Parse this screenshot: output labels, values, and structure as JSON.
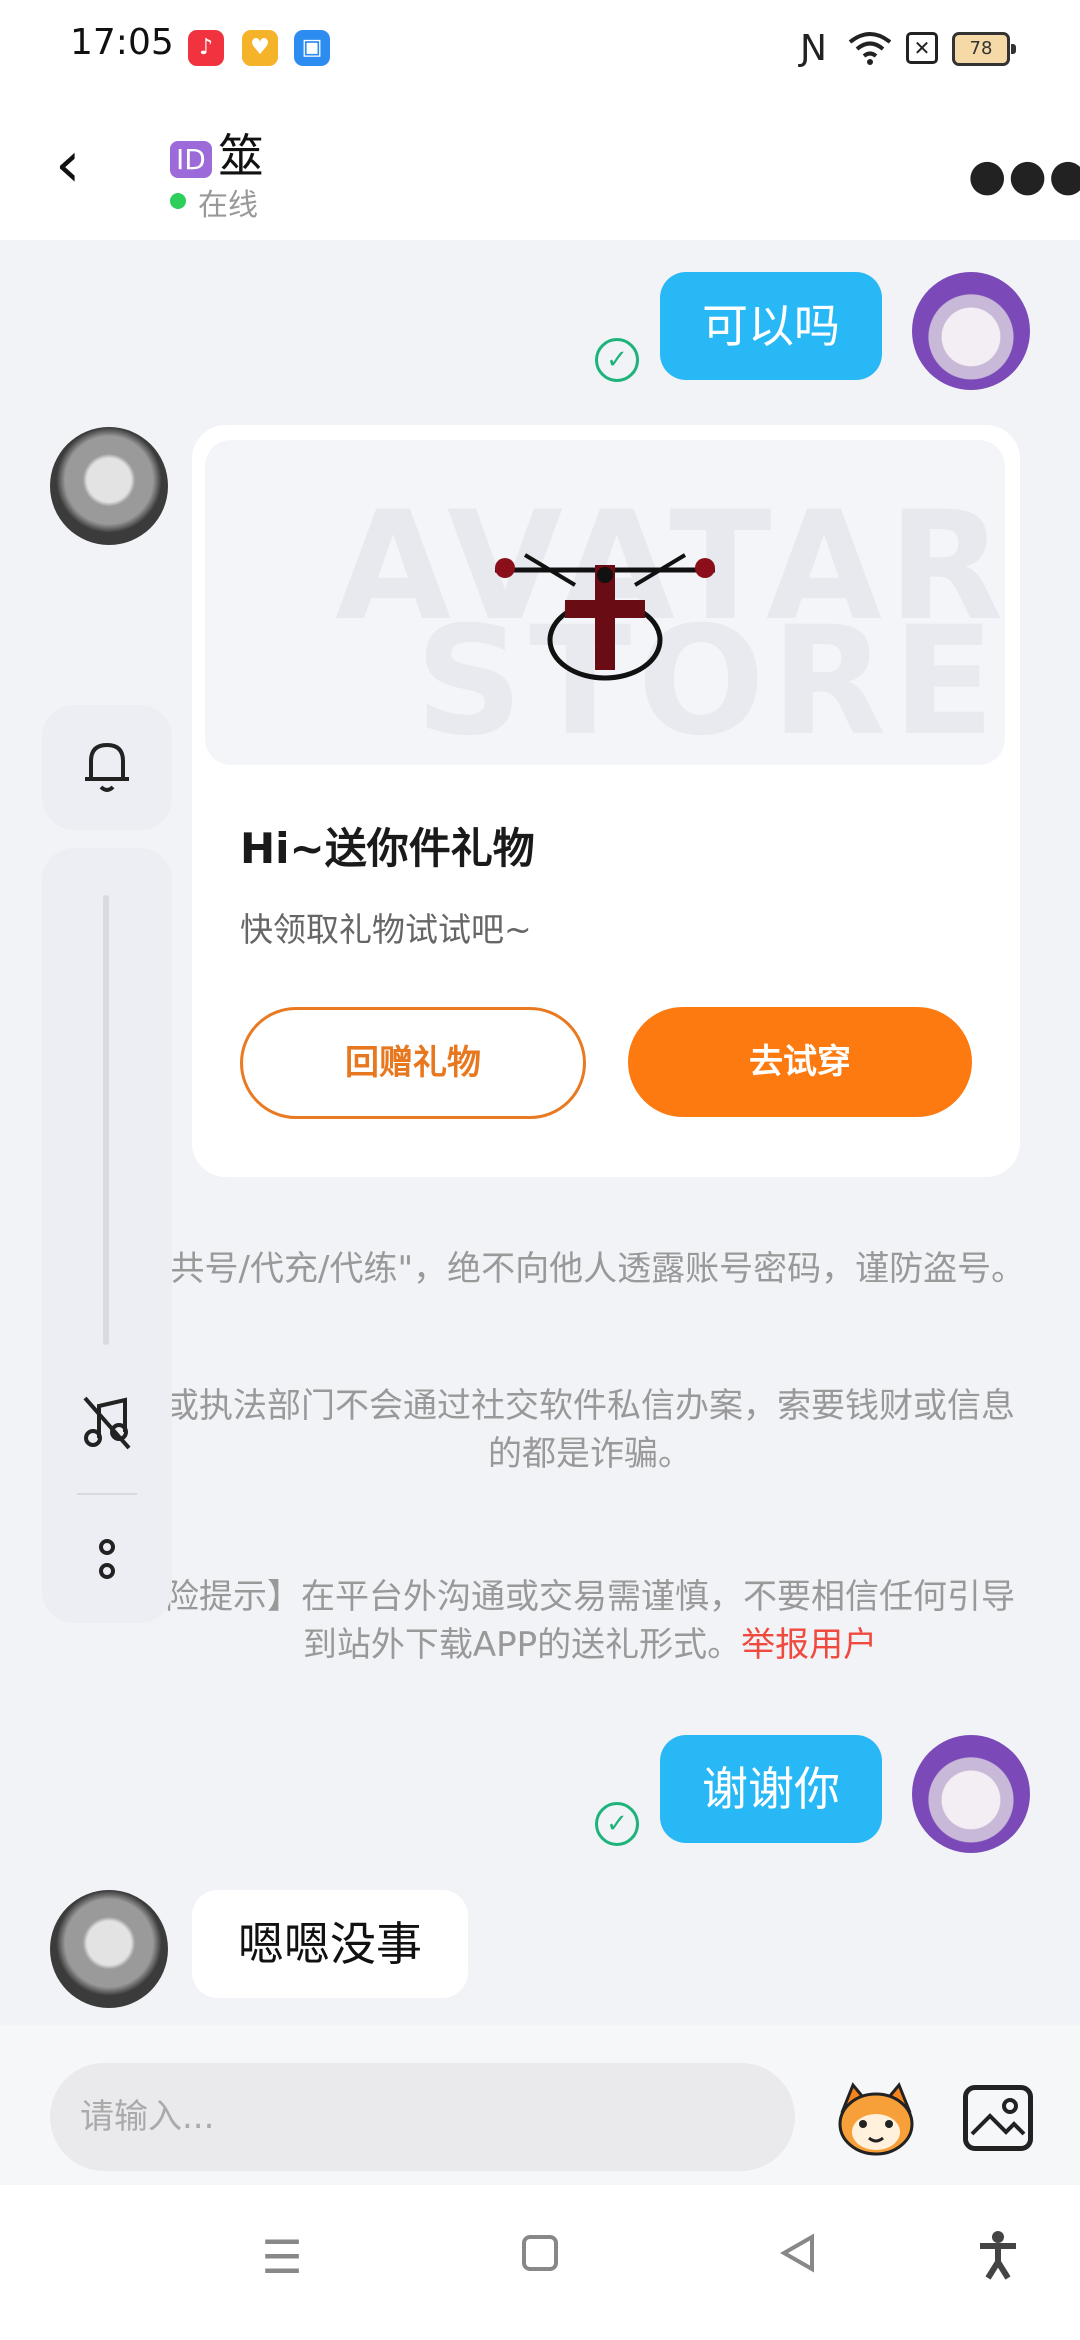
{
  "status_bar": {
    "time": "17:05",
    "battery": "78",
    "app_icons": [
      "music-app-icon",
      "heart-app-icon",
      "blue-app-icon"
    ],
    "system_icons": [
      "nfc-icon",
      "wifi-icon",
      "sim-off-icon",
      "battery-icon"
    ]
  },
  "header": {
    "back_icon": "chevron-left-icon",
    "id_badge": "ID",
    "contact_name": "筮",
    "status": "在线",
    "more_icon": "more-dots-icon"
  },
  "messages": {
    "msg1": {
      "text": "可以吗",
      "sender": "me"
    },
    "gift_card": {
      "image_watermark_line1": "AVATAR",
      "image_watermark_line2": "STORE",
      "title": "Hi~送你件礼物",
      "subtitle": "快领取礼物试试吧~",
      "return_gift_label": "回赠礼物",
      "try_on_label": "去试穿"
    },
    "warning1": "\"共号/代充/代练\"，绝不向他人透露账号密码，谨防盗号。",
    "warning2": "或执法部门不会通过社交软件私信办案，索要钱财或信息的都是诈骗。",
    "warning3": "险提示】在平台外沟通或交易需谨慎，不要相信任何引导到站外下载APP的送礼形式。",
    "report_link": "举报用户",
    "msg2": {
      "text": "谢谢你",
      "sender": "me"
    },
    "msg3": {
      "text": "嗯嗯没事",
      "sender": "them"
    }
  },
  "side_toolbar": {
    "icons": [
      "bell-icon",
      "music-off-icon",
      "more-vertical-icon"
    ]
  },
  "input_bar": {
    "placeholder": "请输入...",
    "emoji_icon": "emoji-mascot-icon",
    "image_icon": "image-icon"
  },
  "nav_bar": {
    "icons": [
      "menu-icon",
      "home-icon",
      "back-icon",
      "accessibility-icon"
    ]
  },
  "colors": {
    "bubble_me": "#28b8f6",
    "accent_orange": "#fc7a10",
    "report_red": "#f04a3f",
    "online_green": "#2bcf5a"
  }
}
